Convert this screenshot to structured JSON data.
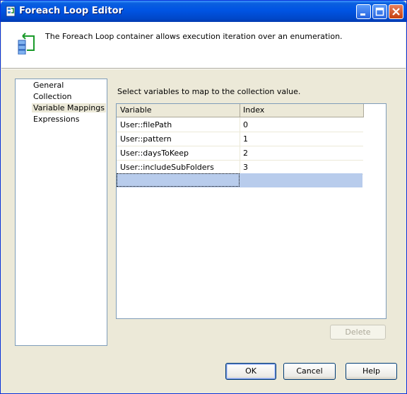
{
  "window": {
    "title": "Foreach Loop Editor"
  },
  "header": {
    "description": "The Foreach Loop container allows execution iteration over an enumeration."
  },
  "nav": {
    "items": [
      {
        "label": "General",
        "selected": false
      },
      {
        "label": "Collection",
        "selected": false
      },
      {
        "label": "Variable Mappings",
        "selected": true
      },
      {
        "label": "Expressions",
        "selected": false
      }
    ]
  },
  "main": {
    "instruction": "Select variables to map to the collection value.",
    "grid": {
      "columns": [
        "Variable",
        "Index"
      ],
      "rows": [
        {
          "variable": "User::filePath",
          "index": "0"
        },
        {
          "variable": "User::pattern",
          "index": "1"
        },
        {
          "variable": "User::daysToKeep",
          "index": "2"
        },
        {
          "variable": "User::includeSubFolders",
          "index": "3"
        }
      ]
    },
    "delete_label": "Delete"
  },
  "footer": {
    "ok_label": "OK",
    "cancel_label": "Cancel",
    "help_label": "Help"
  },
  "colors": {
    "titlebar": "#0054e3",
    "dialog_bg": "#ece9d8",
    "selection": "#b8ccec"
  }
}
